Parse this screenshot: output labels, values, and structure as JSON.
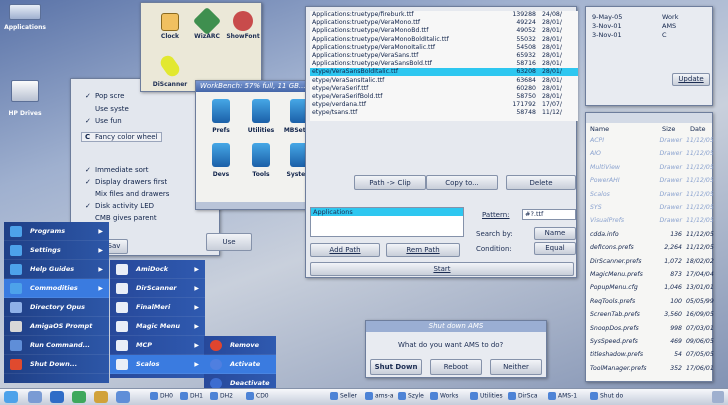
{
  "desktop": {
    "icons": [
      {
        "label": "Applications"
      },
      {
        "label": "HP Drives"
      }
    ]
  },
  "prefs_window": {
    "items": [
      {
        "checked": true,
        "label": "Pop scre"
      },
      {
        "checked": false,
        "label": "Use syste"
      },
      {
        "checked": true,
        "label": "Use fun"
      },
      {
        "checked": false,
        "label": "Fancy color wheel",
        "prefix": "C"
      },
      {
        "checked": true,
        "label": "Immediate sort"
      },
      {
        "checked": true,
        "label": "Display drawers first"
      },
      {
        "checked": false,
        "label": "Mix files and drawers"
      },
      {
        "checked": true,
        "label": "Disk activity LED"
      },
      {
        "checked": false,
        "label": "CMB gives parent"
      }
    ],
    "use_button": "Use",
    "save_button": "Sav"
  },
  "tools_window": {
    "icons": [
      {
        "label": "Clock"
      },
      {
        "label": "WizARC"
      },
      {
        "label": "ShowFont"
      },
      {
        "label": "DiScanner"
      }
    ]
  },
  "drawer_window": {
    "title": "WorkBench: 57% full, 11 GB...",
    "icons": [
      {
        "label": "Prefs"
      },
      {
        "label": "Utilities"
      },
      {
        "label": "MBSetup"
      },
      {
        "label": "Morris.jpg"
      },
      {
        "label": "Devs"
      },
      {
        "label": "Tools"
      },
      {
        "label": "System"
      }
    ]
  },
  "file_list": {
    "rows": [
      {
        "name": "Applications:truetype/fireburk.ttf",
        "size": "139288",
        "date": "24/08/"
      },
      {
        "name": "Applications:truetype/VeraMono.ttf",
        "size": "49224",
        "date": "28/01/"
      },
      {
        "name": "Applications:truetype/VeraMonoBd.ttf",
        "size": "49052",
        "date": "28/01/"
      },
      {
        "name": "Applications:truetype/VeraMonoBoldItalic.ttf",
        "size": "55032",
        "date": "28/01/"
      },
      {
        "name": "Applications:truetype/VeraMonoItalic.ttf",
        "size": "54508",
        "date": "28/01/"
      },
      {
        "name": "Applications:truetype/VeraSans.ttf",
        "size": "65932",
        "date": "28/01/"
      },
      {
        "name": "Applications:truetype/VeraSansBold.ttf",
        "size": "58716",
        "date": "28/01/"
      },
      {
        "name": "etype/VeraSansBoldItalic.ttf",
        "size": "63208",
        "date": "28/01/",
        "selected": true
      },
      {
        "name": "etype/VeraSansItalic.ttf",
        "size": "63684",
        "date": "28/01/"
      },
      {
        "name": "etype/VeraSerif.ttf",
        "size": "60280",
        "date": "28/01/"
      },
      {
        "name": "etype/VeraSerifBold.ttf",
        "size": "58750",
        "date": "28/01/"
      },
      {
        "name": "etype/verdana.ttf",
        "size": "171792",
        "date": "17/07/"
      },
      {
        "name": "etype/tsans.ttf",
        "size": "58748",
        "date": "11/12/"
      }
    ],
    "buttons": {
      "path_clip": "Path -> Clip",
      "copy_to": "Copy to...",
      "delete": "Delete"
    },
    "path_value": "Applications",
    "pattern_label": "Pattern:",
    "pattern_value": "#?.ttf",
    "search_by_label": "Search by:",
    "search_by_value": "Name",
    "condition_label": "Condition:",
    "condition_value": "Equal",
    "add_path": "Add Path",
    "rem_path": "Rem Path",
    "start": "Start"
  },
  "date_window": {
    "dates": [
      "9-May-05",
      "3-Nov-01",
      "3-Nov-01"
    ],
    "options": [
      "Work",
      "AMS",
      "C"
    ],
    "update": "Update"
  },
  "dir_list": {
    "headers": [
      "Name",
      "Size",
      "Date"
    ],
    "rows": [
      {
        "name": "ACPI",
        "size": "Drawer",
        "date": "11/12/05"
      },
      {
        "name": "AIO",
        "size": "Drawer",
        "date": "11/12/05"
      },
      {
        "name": "MultiView",
        "size": "Drawer",
        "date": "11/12/05"
      },
      {
        "name": "PowerAHI",
        "size": "Drawer",
        "date": "11/12/05"
      },
      {
        "name": "Scalos",
        "size": "Drawer",
        "date": "11/12/05"
      },
      {
        "name": "SYS",
        "size": "Drawer",
        "date": "11/12/05"
      },
      {
        "name": "VisualPrefs",
        "size": "Drawer",
        "date": "11/12/05"
      },
      {
        "name": "cdda.info",
        "size": "136",
        "date": "11/12/05"
      },
      {
        "name": "defIcons.prefs",
        "size": "2,264",
        "date": "11/12/05"
      },
      {
        "name": "DirScanner.prefs",
        "size": "1,072",
        "date": "18/02/02"
      },
      {
        "name": "MagicMenu.prefs",
        "size": "873",
        "date": "17/04/04"
      },
      {
        "name": "PopupMenu.cfg",
        "size": "1,046",
        "date": "13/01/01"
      },
      {
        "name": "ReqTools.prefs",
        "size": "100",
        "date": "05/05/99"
      },
      {
        "name": "ScreenTab.prefs",
        "size": "3,560",
        "date": "16/09/05"
      },
      {
        "name": "SnoopDos.prefs",
        "size": "998",
        "date": "07/03/01"
      },
      {
        "name": "SysSpeed.prefs",
        "size": "469",
        "date": "09/06/05"
      },
      {
        "name": "titleshadow.prefs",
        "size": "54",
        "date": "07/05/05"
      },
      {
        "name": "ToolManager.prefs",
        "size": "352",
        "date": "17/06/01"
      }
    ]
  },
  "shutdown": {
    "title": "Shut down AMS",
    "question": "What do you want AMS to do?",
    "buttons": [
      "Shut Down",
      "Reboot",
      "Neither"
    ]
  },
  "start_menu": {
    "items": [
      "Programs",
      "Settings",
      "Help Guides",
      "Commodities",
      "Directory Opus",
      "AmigaOS Prompt",
      "Run Command...",
      "Shut Down..."
    ]
  },
  "submenu1": {
    "items": [
      "AmiDock",
      "DirScanner",
      "FinalMeri",
      "Magic Menu",
      "MCP",
      "Scalos"
    ]
  },
  "submenu2": {
    "items": [
      "Remove",
      "Activate",
      "Deactivate"
    ]
  },
  "taskbar": {
    "items": [
      "DH0",
      "DH1",
      "DH2",
      "CD0",
      "Seller",
      "ams-a",
      "Szyle",
      "Works",
      "Utilities",
      "DirSca",
      "AMS-1",
      "Shut do"
    ]
  },
  "colors": {
    "selection": "#2ec7f0",
    "menu_bg": "#2d57a8",
    "title_bar": "#4466a8"
  }
}
